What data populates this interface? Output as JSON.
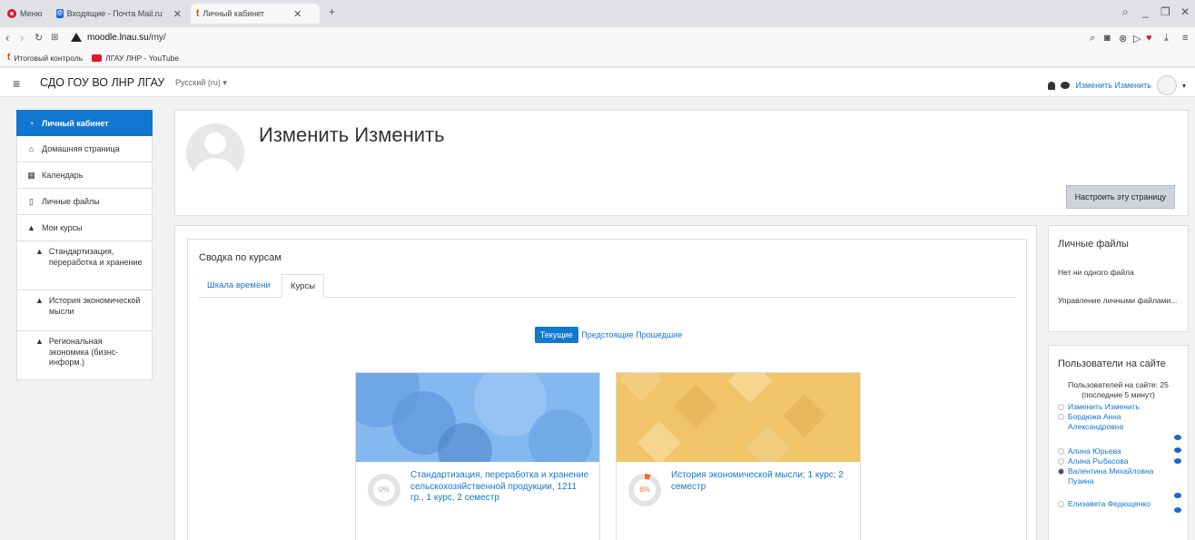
{
  "browser": {
    "tabs": [
      {
        "label": "Меню"
      },
      {
        "label": "Входящие - Почта Mail.ru"
      },
      {
        "label": "Личный кабинет"
      }
    ],
    "url_domain": "moodle.lnau.su",
    "url_path": "/my/",
    "bookmarks": [
      {
        "label": "Итоговый контроль"
      },
      {
        "label": "ЛГАУ ЛНР - YouTube"
      }
    ]
  },
  "navbar": {
    "site_name": "СДО ГОУ ВО ЛНР ЛГАУ",
    "language": "Русский (ru)",
    "user_name": "Изменить Изменить"
  },
  "drawer": {
    "items": [
      {
        "label": "Личный кабинет"
      },
      {
        "label": "Домашняя страница"
      },
      {
        "label": "Календарь"
      },
      {
        "label": "Личные файлы"
      },
      {
        "label": "Мои курсы"
      }
    ],
    "courses": [
      {
        "label": "Стандартизация, переработка и хранение"
      },
      {
        "label": "История экономической мысли"
      },
      {
        "label": "Региональная экономика (бизнс-информ.)"
      }
    ]
  },
  "header": {
    "fullname": "Изменить Изменить",
    "customise_button": "Настроить эту страницу"
  },
  "course_overview": {
    "title": "Сводка по курсам",
    "tabs": [
      "Шкала времени",
      "Курсы"
    ],
    "filters": [
      "Текущие",
      "Предстоящие",
      "Прошедшие"
    ],
    "courses": [
      {
        "name": "Стандартизация, переработка и хранение сельскохозяйственной продукции, 1211 гр., 1 курс, 2 семестр",
        "progress_label": "0%",
        "progress": 0
      },
      {
        "name": "История экономической мысли; 1 курс; 2 семестр",
        "progress_label": "6%",
        "progress": 6
      }
    ]
  },
  "private_files": {
    "title": "Личные файлы",
    "empty_text": "Нет ни одного файла",
    "manage_link": "Управление личными файлами..."
  },
  "online_users": {
    "title": "Пользователи на сайте",
    "summary": "Пользователей на сайте: 25 (последние 5 минут)",
    "users": [
      "Изменить Изменить",
      "Бордюжа Анна Александровна",
      "Алина Юрьева",
      "Алина Рыбасова",
      "Валентина Михайловна Пузина",
      "Елизавета Федющенко"
    ]
  },
  "colors": {
    "accent": "#1177d1",
    "progress": "#f46f25"
  }
}
